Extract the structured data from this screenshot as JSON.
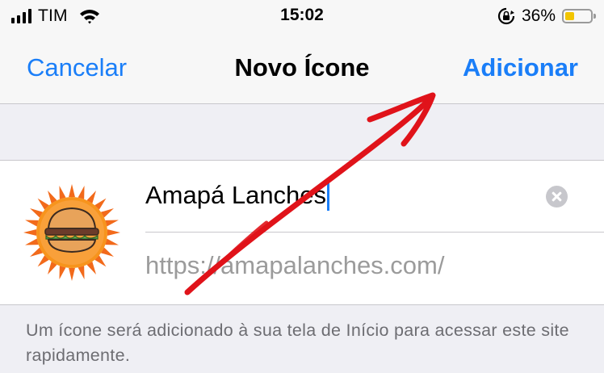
{
  "status_bar": {
    "carrier": "TIM",
    "time": "15:02",
    "battery_percent": "36%",
    "battery_level": 0.36,
    "battery_color": "#f2c500"
  },
  "nav": {
    "cancel_label": "Cancelar",
    "title": "Novo Ícone",
    "add_label": "Adicionar",
    "accent_color": "#1a7ef8"
  },
  "form": {
    "name_value": "Amapá Lanches",
    "url": "https://amapalanches.com/",
    "icon": "burger-sun-logo",
    "clear_icon": "clear-circle-icon"
  },
  "footer": {
    "note": "Um ícone será adicionado à sua tela de Início para acessar este site rapidamente."
  },
  "annotation": {
    "type": "red-hand-drawn-arrow",
    "color": "#e0131a"
  }
}
